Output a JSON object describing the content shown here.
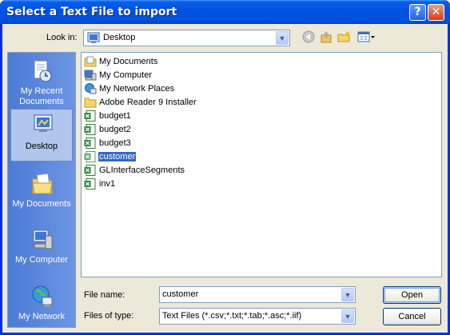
{
  "window": {
    "title": "Select a Text File to import",
    "help_glyph": "?",
    "close_glyph": "✕"
  },
  "toolbar": {
    "look_in_label": "Look in:",
    "look_in_value": "Desktop",
    "icons": [
      "back-icon",
      "up-folder-icon",
      "new-folder-icon",
      "views-menu-icon"
    ]
  },
  "places": [
    {
      "label": "My Recent Documents",
      "icon": "my-recent-documents-icon"
    },
    {
      "label": "Desktop",
      "icon": "desktop-icon",
      "selected": true
    },
    {
      "label": "My Documents",
      "icon": "my-documents-icon"
    },
    {
      "label": "My Computer",
      "icon": "my-computer-icon"
    },
    {
      "label": "My Network",
      "icon": "my-network-icon"
    }
  ],
  "files": [
    {
      "name": "My Documents",
      "icon": "folder-documents-icon"
    },
    {
      "name": "My Computer",
      "icon": "computer-icon"
    },
    {
      "name": "My Network Places",
      "icon": "network-places-icon"
    },
    {
      "name": "Adobe Reader 9 Installer",
      "icon": "folder-icon"
    },
    {
      "name": "budget1",
      "icon": "excel-file-icon"
    },
    {
      "name": "budget2",
      "icon": "excel-file-icon"
    },
    {
      "name": "budget3",
      "icon": "excel-file-icon"
    },
    {
      "name": "customer",
      "icon": "excel-file-icon",
      "selected": true
    },
    {
      "name": "GLInterfaceSegments",
      "icon": "excel-file-icon"
    },
    {
      "name": "inv1",
      "icon": "excel-file-icon"
    }
  ],
  "footer": {
    "file_name_label": "File name:",
    "file_name_value": "customer",
    "files_of_type_label": "Files of type:",
    "files_of_type_value": "Text Files (*.csv;*.txt;*.tab;*.asc;*.iif)",
    "open_label": "Open",
    "cancel_label": "Cancel"
  },
  "colors": {
    "selection": "#316ac5",
    "places_bar": "#5a86dc",
    "dialog_face": "#ece9d8",
    "titlebar": "#0053e1"
  }
}
